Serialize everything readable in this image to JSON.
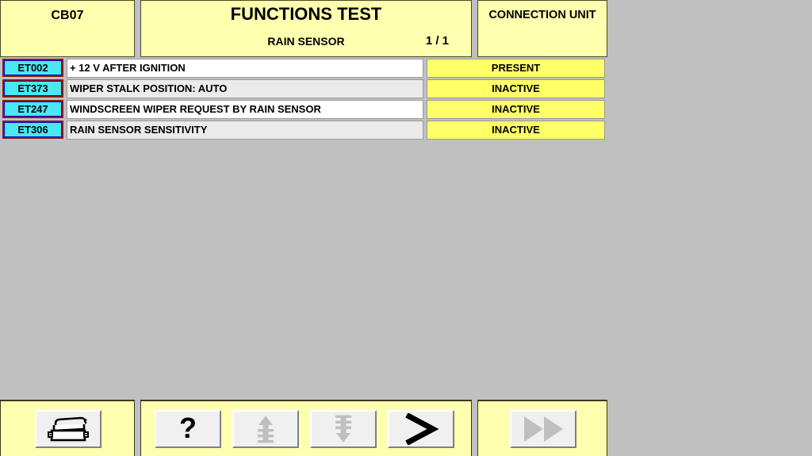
{
  "header": {
    "unit_code": "CB07",
    "title": "FUNCTIONS TEST",
    "subtitle": "RAIN SENSOR",
    "page_indicator": "1 / 1",
    "connection_label": "CONNECTION UNIT"
  },
  "table": {
    "rows": [
      {
        "code": "ET002",
        "description": "+ 12 V AFTER IGNITION",
        "value": "PRESENT"
      },
      {
        "code": "ET373",
        "description": "WIPER STALK POSITION: AUTO",
        "value": "INACTIVE"
      },
      {
        "code": "ET247",
        "description": "WINDSCREEN WIPER REQUEST BY RAIN SENSOR",
        "value": "INACTIVE"
      },
      {
        "code": "ET306",
        "description": "RAIN SENSOR SENSITIVITY",
        "value": "INACTIVE"
      }
    ]
  },
  "toolbar": {
    "print_icon": "printer-icon",
    "help_icon": "question-mark-icon",
    "scroll_up_icon": "scroll-up-arrow-icon",
    "scroll_down_icon": "scroll-down-arrow-icon",
    "next_icon": "greater-than-chevron-icon",
    "fast_forward_icon": "fast-forward-icon",
    "help_glyph": "?",
    "next_glyph": ">"
  },
  "colors": {
    "panel_yellow": "#ffffb0",
    "value_yellow": "#ffff66",
    "badge_cyan": "#4ae8f5",
    "badge_border_red": "#8b1a16",
    "badge_border_blue": "#0a0ad0",
    "background_gray": "#c0c0c0",
    "row_white": "#ffffff",
    "row_gray": "#ebebeb",
    "disabled_gray": "#bfbfbf"
  }
}
